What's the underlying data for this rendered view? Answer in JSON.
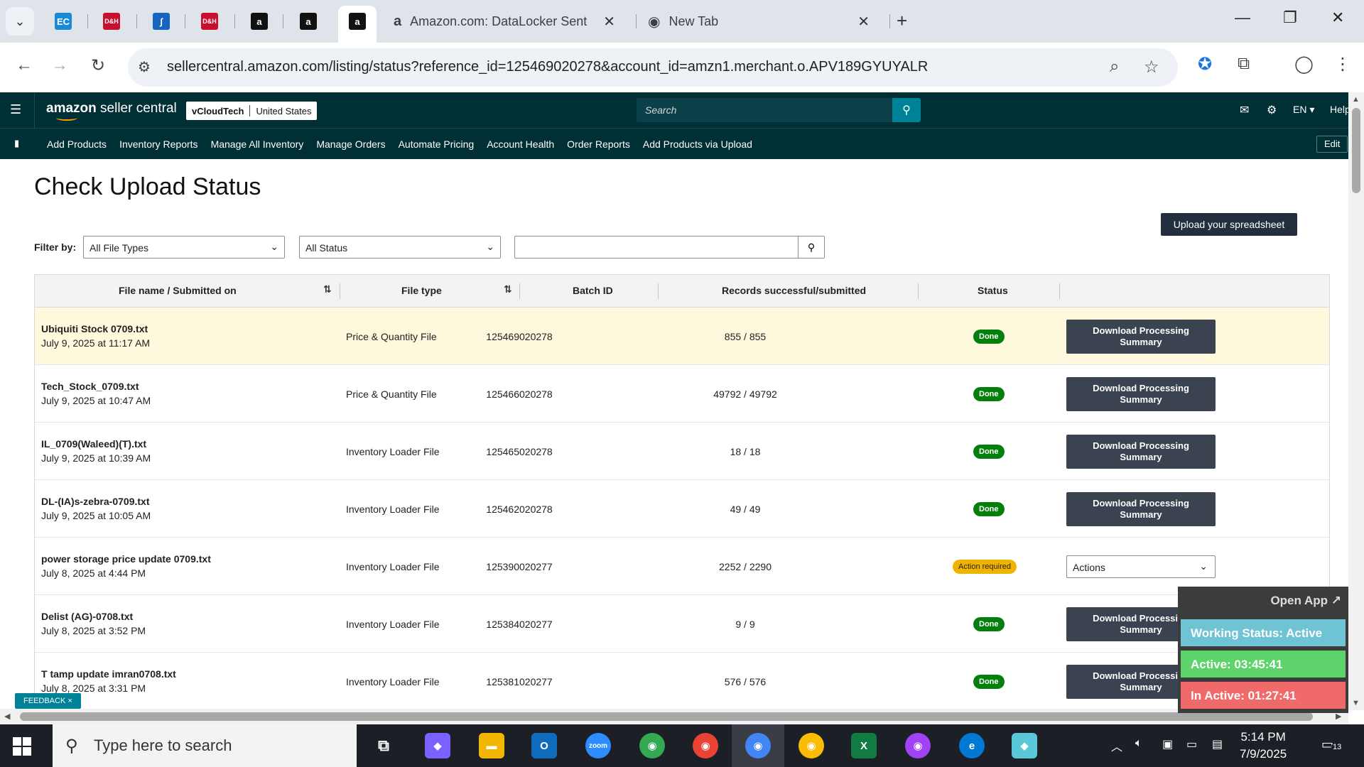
{
  "browser": {
    "pinned_tabs": [
      {
        "name": "EC",
        "color": "#1a8ad4"
      },
      {
        "name": "D&H",
        "color": "#c8102e"
      },
      {
        "name": "clip",
        "color": "#1565c0"
      },
      {
        "name": "D&H",
        "color": "#c8102e"
      },
      {
        "name": "a",
        "color": "#111111"
      },
      {
        "name": "a",
        "color": "#111111"
      },
      {
        "name": "a",
        "color": "#111111"
      }
    ],
    "tabs": [
      {
        "title": "Amazon.com: DataLocker Sentr",
        "active": false
      },
      {
        "title": "New Tab",
        "active": false
      }
    ],
    "url": "sellercentral.amazon.com/listing/status?reference_id=125469020278&account_id=amzn1.merchant.o.APV189GYUYALR"
  },
  "header": {
    "logo_bold": "amazon",
    "logo_rest": " seller central",
    "account": "vCloudTech",
    "marketplace": "United States",
    "search_placeholder": "Search",
    "lang": "EN ▾",
    "help": "Help"
  },
  "nav": {
    "links": [
      "Add Products",
      "Inventory Reports",
      "Manage All Inventory",
      "Manage Orders",
      "Automate Pricing",
      "Account Health",
      "Order Reports",
      "Add Products via Upload"
    ],
    "edit": "Edit"
  },
  "page": {
    "title": "Check Upload Status",
    "upload_button": "Upload your spreadsheet",
    "filter_label": "Filter by:",
    "file_type_filter": "All File Types",
    "status_filter": "All Status"
  },
  "table": {
    "headers": {
      "file": "File name / Submitted on",
      "type": "File type",
      "batch": "Batch ID",
      "records": "Records successful/submitted",
      "status": "Status"
    },
    "download_label_1": "Download Processing",
    "download_label_2": "Summary",
    "actions_label": "Actions",
    "rows": [
      {
        "name": "Ubiquiti Stock 0709.txt",
        "date": "July 9, 2025 at 11:17 AM",
        "type": "Price & Quantity File",
        "batch": "125469020278",
        "records": "855 / 855",
        "status": "Done"
      },
      {
        "name": "Tech_Stock_0709.txt",
        "date": "July 9, 2025 at 10:47 AM",
        "type": "Price & Quantity File",
        "batch": "125466020278",
        "records": "49792 / 49792",
        "status": "Done"
      },
      {
        "name": "IL_0709(Waleed)(T).txt",
        "date": "July 9, 2025 at 10:39 AM",
        "type": "Inventory Loader File",
        "batch": "125465020278",
        "records": "18 / 18",
        "status": "Done"
      },
      {
        "name": "DL-(IA)s-zebra-0709.txt",
        "date": "July 9, 2025 at 10:05 AM",
        "type": "Inventory Loader File",
        "batch": "125462020278",
        "records": "49 / 49",
        "status": "Done"
      },
      {
        "name": "power storage price update 0709.txt",
        "date": "July 8, 2025 at 4:44 PM",
        "type": "Inventory Loader File",
        "batch": "125390020277",
        "records": "2252 / 2290",
        "status": "Action required"
      },
      {
        "name": "Delist (AG)-0708.txt",
        "date": "July 8, 2025 at 3:52 PM",
        "type": "Inventory Loader File",
        "batch": "125384020277",
        "records": "9 / 9",
        "status": "Done"
      },
      {
        "name": "T tamp update imran0708.txt",
        "date": "July 8, 2025 at 3:31 PM",
        "type": "Inventory Loader File",
        "batch": "125381020277",
        "records": "576 / 576",
        "status": "Done"
      }
    ]
  },
  "feedback": "FEEDBACK ×",
  "overlay": {
    "open_app": "Open App ↗",
    "working": "Working Status: Active",
    "active": "Active: 03:45:41",
    "inactive": "In Active: 01:27:41"
  },
  "taskbar": {
    "search_placeholder": "Type here to search",
    "time": "5:14 PM",
    "date": "7/9/2025",
    "notifications": "13"
  }
}
